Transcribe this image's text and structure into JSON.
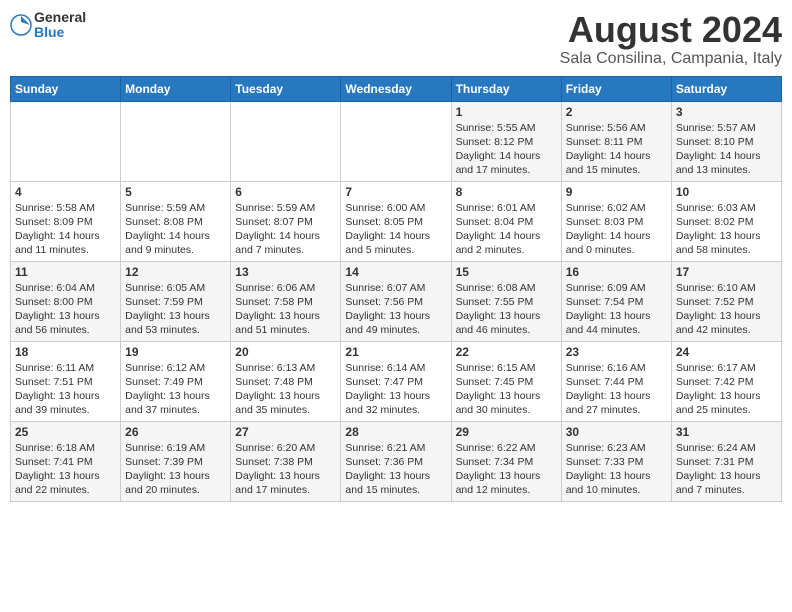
{
  "logo": {
    "general": "General",
    "blue": "Blue"
  },
  "title": "August 2024",
  "subtitle": "Sala Consilina, Campania, Italy",
  "days_of_week": [
    "Sunday",
    "Monday",
    "Tuesday",
    "Wednesday",
    "Thursday",
    "Friday",
    "Saturday"
  ],
  "weeks": [
    [
      {
        "day": "",
        "info": ""
      },
      {
        "day": "",
        "info": ""
      },
      {
        "day": "",
        "info": ""
      },
      {
        "day": "",
        "info": ""
      },
      {
        "day": "1",
        "info": "Sunrise: 5:55 AM\nSunset: 8:12 PM\nDaylight: 14 hours\nand 17 minutes."
      },
      {
        "day": "2",
        "info": "Sunrise: 5:56 AM\nSunset: 8:11 PM\nDaylight: 14 hours\nand 15 minutes."
      },
      {
        "day": "3",
        "info": "Sunrise: 5:57 AM\nSunset: 8:10 PM\nDaylight: 14 hours\nand 13 minutes."
      }
    ],
    [
      {
        "day": "4",
        "info": "Sunrise: 5:58 AM\nSunset: 8:09 PM\nDaylight: 14 hours\nand 11 minutes."
      },
      {
        "day": "5",
        "info": "Sunrise: 5:59 AM\nSunset: 8:08 PM\nDaylight: 14 hours\nand 9 minutes."
      },
      {
        "day": "6",
        "info": "Sunrise: 5:59 AM\nSunset: 8:07 PM\nDaylight: 14 hours\nand 7 minutes."
      },
      {
        "day": "7",
        "info": "Sunrise: 6:00 AM\nSunset: 8:05 PM\nDaylight: 14 hours\nand 5 minutes."
      },
      {
        "day": "8",
        "info": "Sunrise: 6:01 AM\nSunset: 8:04 PM\nDaylight: 14 hours\nand 2 minutes."
      },
      {
        "day": "9",
        "info": "Sunrise: 6:02 AM\nSunset: 8:03 PM\nDaylight: 14 hours\nand 0 minutes."
      },
      {
        "day": "10",
        "info": "Sunrise: 6:03 AM\nSunset: 8:02 PM\nDaylight: 13 hours\nand 58 minutes."
      }
    ],
    [
      {
        "day": "11",
        "info": "Sunrise: 6:04 AM\nSunset: 8:00 PM\nDaylight: 13 hours\nand 56 minutes."
      },
      {
        "day": "12",
        "info": "Sunrise: 6:05 AM\nSunset: 7:59 PM\nDaylight: 13 hours\nand 53 minutes."
      },
      {
        "day": "13",
        "info": "Sunrise: 6:06 AM\nSunset: 7:58 PM\nDaylight: 13 hours\nand 51 minutes."
      },
      {
        "day": "14",
        "info": "Sunrise: 6:07 AM\nSunset: 7:56 PM\nDaylight: 13 hours\nand 49 minutes."
      },
      {
        "day": "15",
        "info": "Sunrise: 6:08 AM\nSunset: 7:55 PM\nDaylight: 13 hours\nand 46 minutes."
      },
      {
        "day": "16",
        "info": "Sunrise: 6:09 AM\nSunset: 7:54 PM\nDaylight: 13 hours\nand 44 minutes."
      },
      {
        "day": "17",
        "info": "Sunrise: 6:10 AM\nSunset: 7:52 PM\nDaylight: 13 hours\nand 42 minutes."
      }
    ],
    [
      {
        "day": "18",
        "info": "Sunrise: 6:11 AM\nSunset: 7:51 PM\nDaylight: 13 hours\nand 39 minutes."
      },
      {
        "day": "19",
        "info": "Sunrise: 6:12 AM\nSunset: 7:49 PM\nDaylight: 13 hours\nand 37 minutes."
      },
      {
        "day": "20",
        "info": "Sunrise: 6:13 AM\nSunset: 7:48 PM\nDaylight: 13 hours\nand 35 minutes."
      },
      {
        "day": "21",
        "info": "Sunrise: 6:14 AM\nSunset: 7:47 PM\nDaylight: 13 hours\nand 32 minutes."
      },
      {
        "day": "22",
        "info": "Sunrise: 6:15 AM\nSunset: 7:45 PM\nDaylight: 13 hours\nand 30 minutes."
      },
      {
        "day": "23",
        "info": "Sunrise: 6:16 AM\nSunset: 7:44 PM\nDaylight: 13 hours\nand 27 minutes."
      },
      {
        "day": "24",
        "info": "Sunrise: 6:17 AM\nSunset: 7:42 PM\nDaylight: 13 hours\nand 25 minutes."
      }
    ],
    [
      {
        "day": "25",
        "info": "Sunrise: 6:18 AM\nSunset: 7:41 PM\nDaylight: 13 hours\nand 22 minutes."
      },
      {
        "day": "26",
        "info": "Sunrise: 6:19 AM\nSunset: 7:39 PM\nDaylight: 13 hours\nand 20 minutes."
      },
      {
        "day": "27",
        "info": "Sunrise: 6:20 AM\nSunset: 7:38 PM\nDaylight: 13 hours\nand 17 minutes."
      },
      {
        "day": "28",
        "info": "Sunrise: 6:21 AM\nSunset: 7:36 PM\nDaylight: 13 hours\nand 15 minutes."
      },
      {
        "day": "29",
        "info": "Sunrise: 6:22 AM\nSunset: 7:34 PM\nDaylight: 13 hours\nand 12 minutes."
      },
      {
        "day": "30",
        "info": "Sunrise: 6:23 AM\nSunset: 7:33 PM\nDaylight: 13 hours\nand 10 minutes."
      },
      {
        "day": "31",
        "info": "Sunrise: 6:24 AM\nSunset: 7:31 PM\nDaylight: 13 hours\nand 7 minutes."
      }
    ]
  ]
}
